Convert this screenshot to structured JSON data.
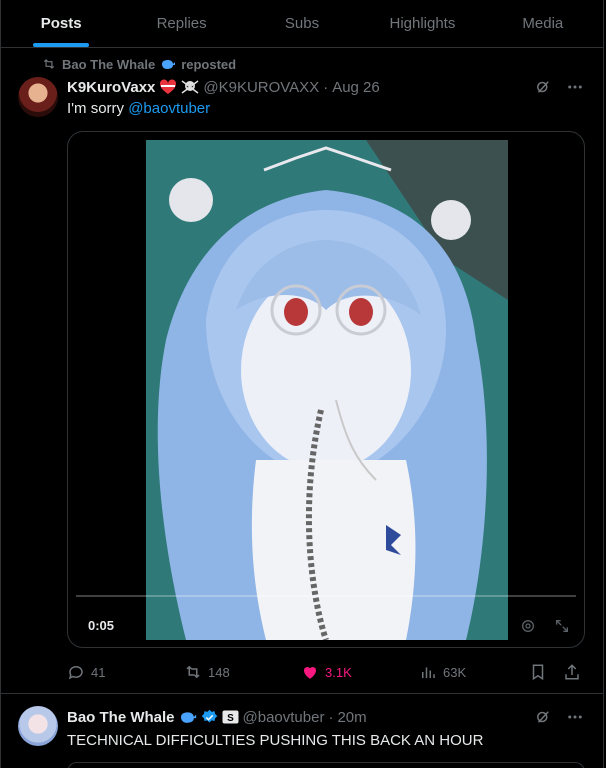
{
  "tabs": [
    {
      "label": "Posts",
      "active": true
    },
    {
      "label": "Replies",
      "active": false
    },
    {
      "label": "Subs",
      "active": false
    },
    {
      "label": "Highlights",
      "active": false
    },
    {
      "label": "Media",
      "active": false
    }
  ],
  "post1": {
    "repost_by": "Bao The Whale",
    "repost_suffix": "reposted",
    "author_name": "K9KuroVaxx",
    "author_handle": "@K9KUROVAXX",
    "separator": "·",
    "time": "Aug 26",
    "text": "I'm sorry ",
    "mention": "@baovtuber",
    "video_time": "0:05",
    "replies": "41",
    "reposts": "148",
    "likes": "3.1K",
    "views": "63K"
  },
  "post2": {
    "author_name": "Bao The Whale",
    "author_handle": "@baovtuber",
    "separator": "·",
    "time": "20m",
    "text": "TECHNICAL DIFFICULTIES PUSHING THIS BACK AN HOUR"
  },
  "colors": {
    "accent": "#1d9bf0",
    "like": "#f91880",
    "muted": "#71767b",
    "text": "#e7e9ea",
    "border": "#2f3336"
  }
}
